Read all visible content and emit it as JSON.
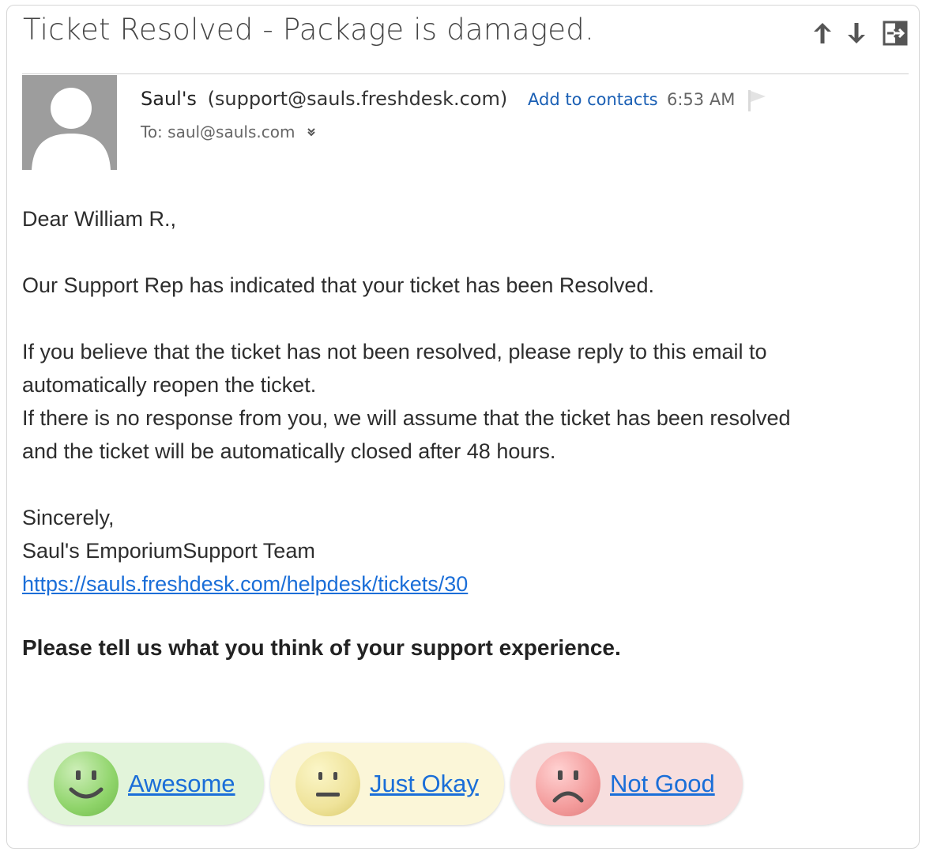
{
  "email": {
    "subject": "Ticket Resolved - Package is damaged.",
    "sender_name": "Saul's",
    "sender_email": "(support@sauls.freshdesk.com)",
    "add_contact_label": "Add to contacts",
    "time": "6:53 AM",
    "to_line": "To: saul@sauls.com",
    "body": {
      "greeting": "Dear William R.,",
      "line1": "Our Support Rep has indicated that your ticket has been Resolved.",
      "line2": "If you believe that the ticket has not been resolved, please reply to this email to",
      "line3": "automatically reopen the ticket.",
      "line4": "If there is no response from you, we will assume that the ticket has been resolved",
      "line5": "and the ticket will be automatically closed after 48 hours.",
      "signoff": "Sincerely,",
      "team": "Saul's EmporiumSupport Team",
      "ticket_link": "https://sauls.freshdesk.com/helpdesk/tickets/30",
      "feedback_prompt": "Please tell us what you think of your support experience."
    },
    "ratings": [
      {
        "label": "Awesome",
        "color": "#e2f4da",
        "icon": "smile-face-icon"
      },
      {
        "label": "Just Okay",
        "color": "#fbf6d8",
        "icon": "neutral-face-icon"
      },
      {
        "label": "Not Good",
        "color": "#f7dede",
        "icon": "sad-face-icon"
      }
    ]
  },
  "toolbar": {
    "icons": [
      "arrow-up-icon",
      "arrow-down-icon",
      "popout-icon"
    ]
  },
  "colors": {
    "link": "#1a6ed8",
    "contact_link": "#1a5fb4",
    "avatar_bg": "#9d9d9d"
  }
}
